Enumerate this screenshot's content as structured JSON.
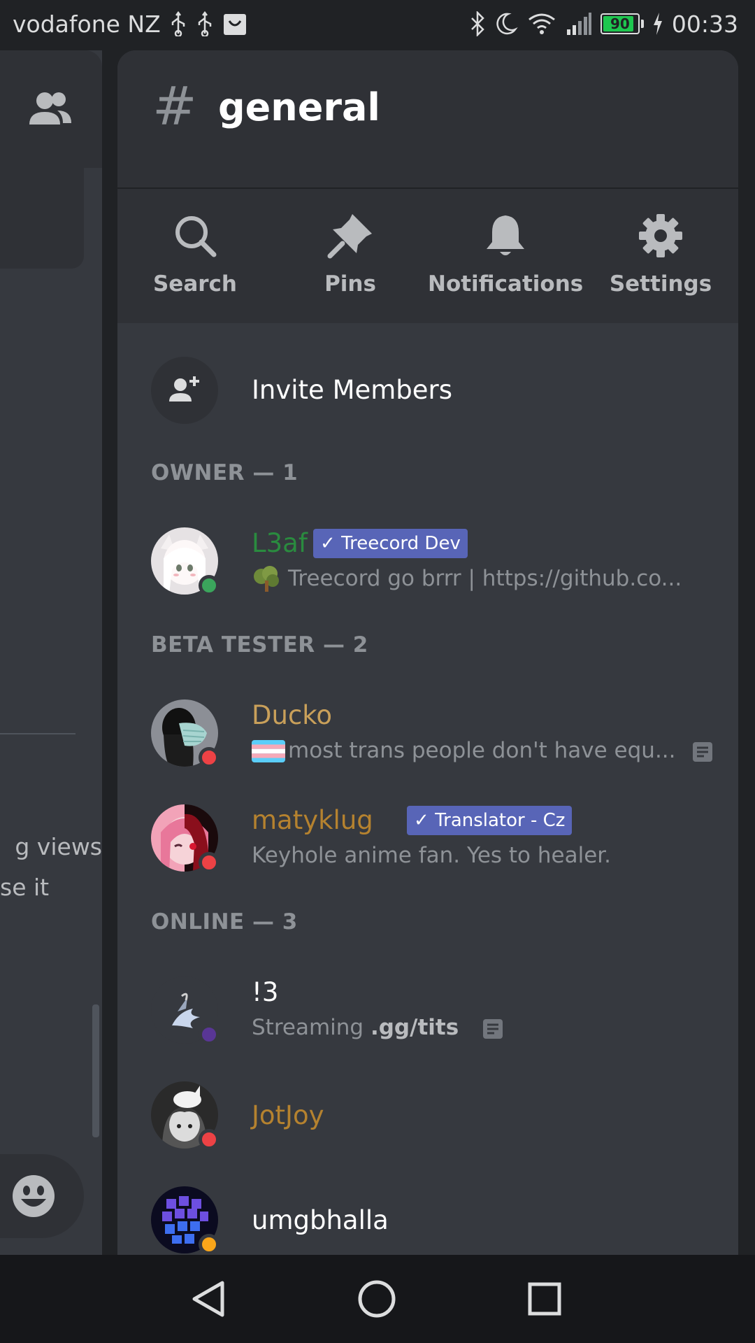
{
  "statusbar": {
    "carrier": "vodafone NZ",
    "battery": "90",
    "battery_level": 0.9,
    "time": "00:33",
    "icons": [
      "usb-icon",
      "usb-icon",
      "shopping-bag-icon",
      "bluetooth-icon",
      "moon-icon",
      "wifi-icon",
      "signal-icon",
      "charging-icon"
    ]
  },
  "background": {
    "text_line1": "g views",
    "text_line2": "se it"
  },
  "channel": {
    "hash": "#",
    "name": "general"
  },
  "actions": [
    {
      "label": "Search",
      "icon": "search-icon"
    },
    {
      "label": "Pins",
      "icon": "pin-icon"
    },
    {
      "label": "Notifications",
      "icon": "bell-icon"
    },
    {
      "label": "Settings",
      "icon": "gear-icon"
    }
  ],
  "invite": {
    "label": "Invite Members",
    "icon": "add-user-icon"
  },
  "sections": [
    {
      "title": "OWNER — 1"
    },
    {
      "title": "BETA TESTER — 2"
    },
    {
      "title": "ONLINE — 3"
    }
  ],
  "members": [
    {
      "name": "L3af",
      "name_color": "#2a8b3f",
      "tag": "Treecord Dev",
      "status_emoji": "tree-icon",
      "status_text": "Treecord go brrr | https://github.co...",
      "presence": "online",
      "presence_color": "#3ba55c"
    },
    {
      "name": "Ducko",
      "name_color": "#c9a05a",
      "tag": "",
      "status_emoji": "trans-flag-icon",
      "status_text": "most trans people don't have equ...",
      "presence": "dnd",
      "presence_color": "#ed4245"
    },
    {
      "name": "matyklug",
      "name_color": "#b5822f",
      "tag": "Translator - Cz",
      "status_emoji": "",
      "status_text": "Keyhole anime fan. Yes to healer.",
      "presence": "dnd",
      "presence_color": "#ed4245"
    },
    {
      "name": "!3",
      "name_color": "#ffffff",
      "tag": "",
      "status_emoji": "",
      "status_prefix": "Streaming ",
      "status_bold": ".gg/tits",
      "presence": "streaming",
      "presence_color": "#593695"
    },
    {
      "name": "JotJoy",
      "name_color": "#b5822f",
      "tag": "",
      "status_emoji": "",
      "status_text": "",
      "presence": "dnd",
      "presence_color": "#ed4245"
    },
    {
      "name": "umgbhalla",
      "name_color": "#ffffff",
      "tag": "",
      "status_emoji": "",
      "status_text": "",
      "presence": "idle",
      "presence_color": "#faa61a"
    }
  ],
  "navbar": {
    "buttons": [
      "back-icon",
      "home-icon",
      "recents-icon"
    ]
  }
}
